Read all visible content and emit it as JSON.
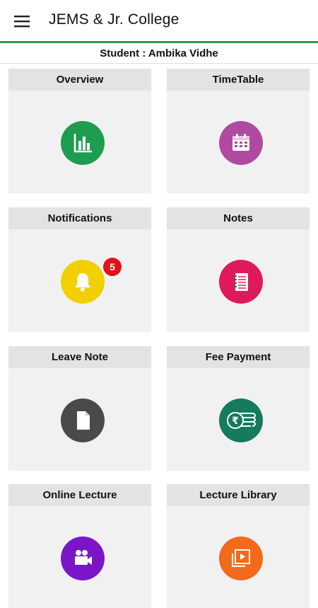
{
  "header": {
    "title": "JEMS & Jr. College",
    "menu_icon": "hamburger-menu-icon"
  },
  "student": {
    "label": "Student : Ambika Vidhe"
  },
  "accent_color": "#2e9e4a",
  "tiles": [
    {
      "label": "Overview",
      "icon": "bar-chart-icon",
      "color": "#1e9c50"
    },
    {
      "label": "TimeTable",
      "icon": "calendar-icon",
      "color": "#b04aa0"
    },
    {
      "label": "Notifications",
      "icon": "bell-icon",
      "color": "#f2d000",
      "badge": "5"
    },
    {
      "label": "Notes",
      "icon": "notebook-icon",
      "color": "#e01a5a"
    },
    {
      "label": "Leave Note",
      "icon": "document-icon",
      "color": "#4a4a4a"
    },
    {
      "label": "Fee Payment",
      "icon": "rupee-coins-icon",
      "color": "#167a5e"
    },
    {
      "label": "Online Lecture",
      "icon": "video-camera-icon",
      "color": "#7a16c8"
    },
    {
      "label": "Lecture Library",
      "icon": "video-library-icon",
      "color": "#f26a1a"
    }
  ]
}
